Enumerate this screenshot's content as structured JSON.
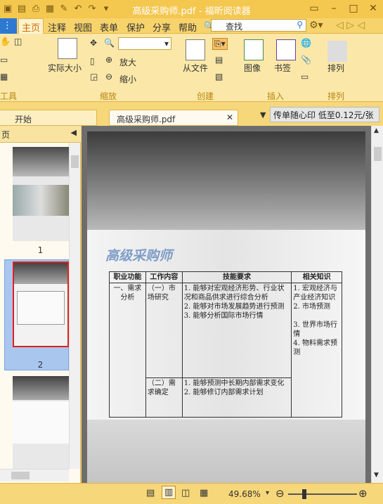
{
  "window": {
    "title": "高级采购师.pdf - 福昕阅读器"
  },
  "menu": [
    "主页",
    "注释",
    "视图",
    "表单",
    "保护",
    "分享",
    "帮助"
  ],
  "search": {
    "value": "查找"
  },
  "ribbon": {
    "actual_size": "实际大小",
    "zoom_in": "放大",
    "zoom_out": "缩小",
    "zoom_group": "缩放",
    "from_file": "从文件",
    "create_group": "创建",
    "image": "图像",
    "bookmark": "书签",
    "insert_group": "插入",
    "arrange": "排列",
    "arrange_group": "排列",
    "tools_group": "工具"
  },
  "tabs": {
    "start": "开始",
    "doc": "高级采购师.pdf"
  },
  "ad": "传单随心印 低至0.12元/张",
  "sidebar": {
    "title": "页",
    "pages": [
      "1",
      "2"
    ]
  },
  "doc": {
    "heading": "高级采购师",
    "headers": [
      "职业功能",
      "工作内容",
      "技能要求",
      "相关知识"
    ],
    "row1": {
      "func": "一、需求分析",
      "work": "（一）市场研究",
      "skills": "1. 能够对宏观经济形势、行业状况和商品供求进行综合分析\n2. 能够对市场发展趋势进行预测\n3. 能够分析国际市场行情",
      "knowledge": "1. 宏观经济与产业经济知识\n2. 市场预测\n\n3. 世界市场行情\n4. 物料需求预测"
    },
    "row2": {
      "work": "（二）需求确定",
      "skills": "1. 能够预测中长期内部需求变化\n2. 能够修订内部需求计划"
    }
  },
  "status": {
    "zoom": "49.68%"
  }
}
